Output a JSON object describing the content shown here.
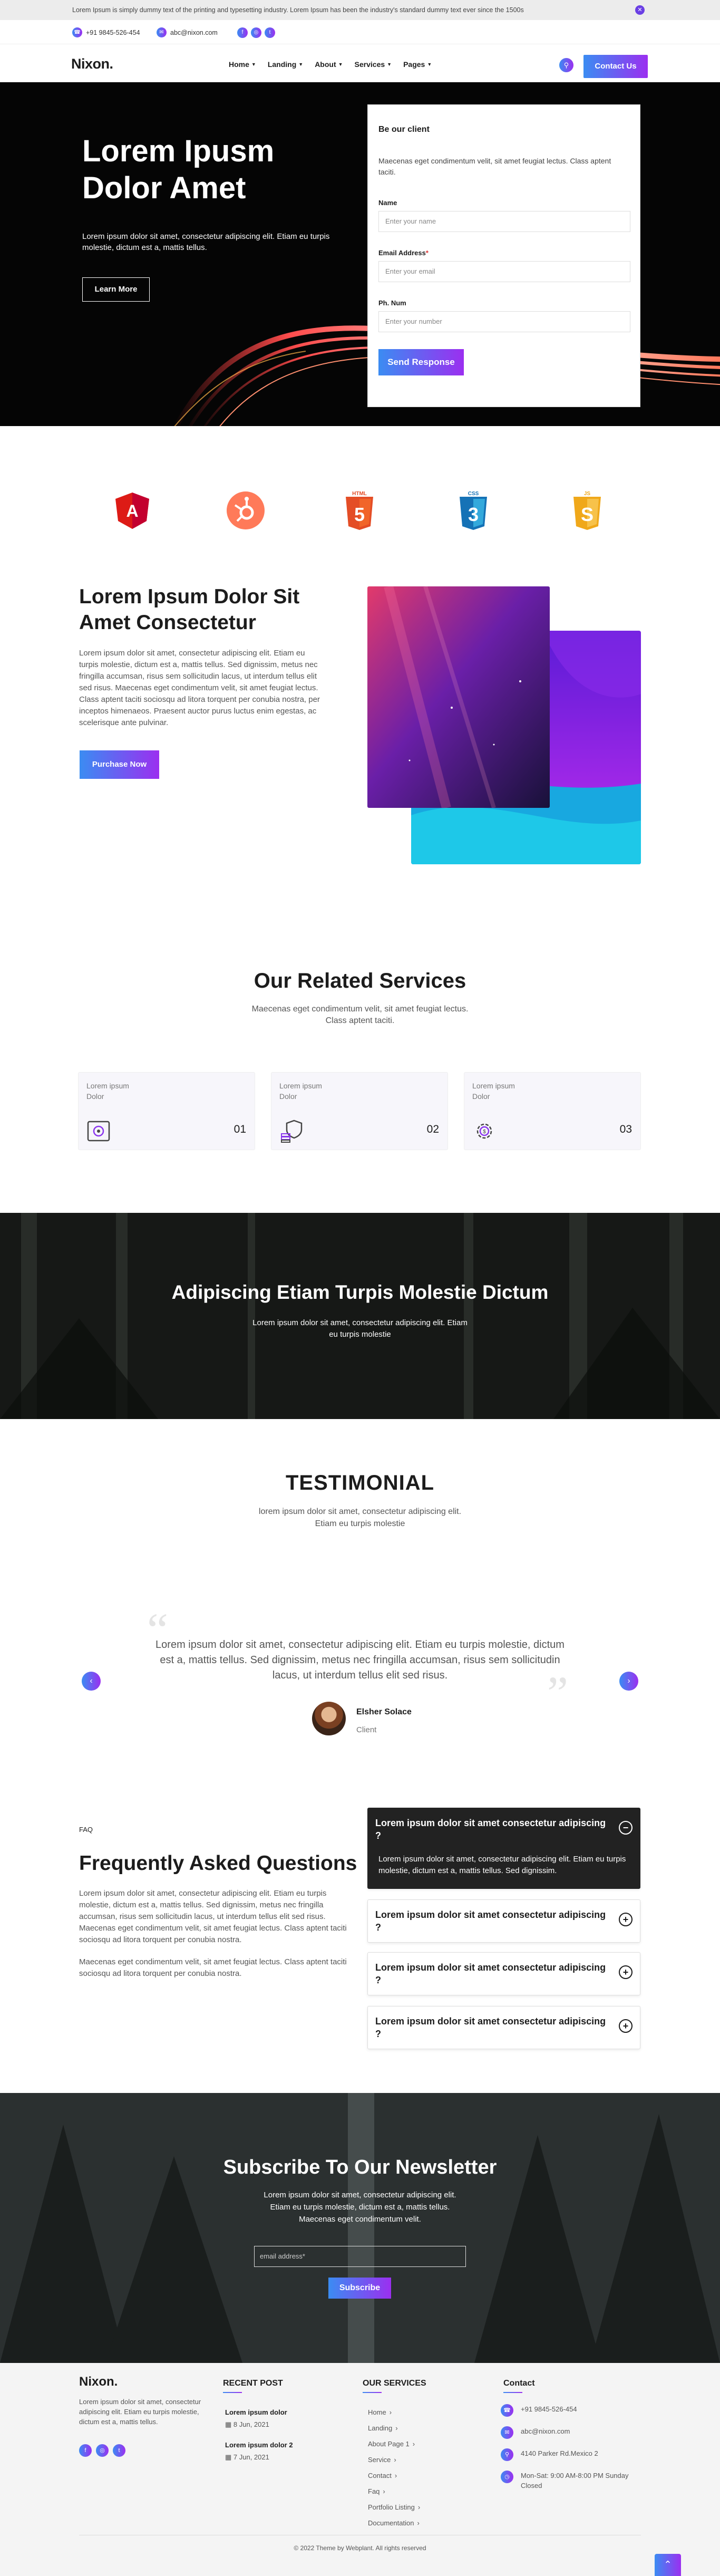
{
  "topbar": {
    "text": "Lorem Ipsum is simply dummy text of the printing and typesetting industry. Lorem Ipsum has been the industry's standard dummy text ever since the 1500s",
    "close_icon": "x-icon"
  },
  "contact": {
    "phone": "+91 9845-526-454",
    "email": "abc@nixon.com"
  },
  "nav": {
    "logo": "Nixon.",
    "items": [
      "Home",
      "Landing",
      "About",
      "Services",
      "Pages"
    ],
    "cta": "Contact Us"
  },
  "hero": {
    "title": "Lorem Ipusm Dolor Amet",
    "text": "Lorem ipsum dolor sit amet, consectetur adipiscing elit. Etiam eu turpis molestie, dictum est a, mattis tellus.",
    "button": "Learn More"
  },
  "form": {
    "title": "Be our client",
    "text": "Maecenas eget condimentum velit, sit amet feugiat lectus. Class aptent taciti.",
    "name_label": "Name",
    "name_ph": "Enter your name",
    "email_label": "Email Address",
    "req": "*",
    "email_ph": "Enter your email",
    "phone_label": "Ph. Num",
    "phone_ph": "Enter your number",
    "button": "Send Response"
  },
  "logos": [
    {
      "name": "angular",
      "text": "A",
      "color": "#dd1b16"
    },
    {
      "name": "hubspot",
      "text": "",
      "color": "#ff7a59"
    },
    {
      "name": "html5",
      "text": "5",
      "label": "HTML",
      "color": "#e44d26"
    },
    {
      "name": "css3",
      "text": "3",
      "label": "CSS",
      "color": "#1572b6"
    },
    {
      "name": "js",
      "text": "S",
      "label": "JS",
      "color": "#f0a81a"
    }
  ],
  "about": {
    "title": "Lorem Ipsum Dolor Sit Amet Consectetur",
    "text": "Lorem ipsum dolor sit amet, consectetur adipiscing elit. Etiam eu turpis molestie, dictum est a, mattis tellus. Sed dignissim, metus nec fringilla accumsan, risus sem sollicitudin lacus, ut interdum tellus elit sed risus. Maecenas eget condimentum velit, sit amet feugiat lectus. Class aptent taciti sociosqu ad litora torquent per conubia nostra, per inceptos himenaeos. Praesent auctor purus luctus enim egestas, ac scelerisque ante pulvinar.",
    "button": "Purchase Now"
  },
  "services": {
    "title": "Our Related Services",
    "sub": "Maecenas eget condimentum velit, sit amet feugiat lectus. Class aptent taciti.",
    "cards": [
      {
        "label": "Lorem ipsum Dolor",
        "num": "01",
        "icon": "safe-icon"
      },
      {
        "label": "Lorem ipsum Dolor",
        "num": "02",
        "icon": "shield-coins-icon"
      },
      {
        "label": "Lorem ipsum Dolor",
        "num": "03",
        "icon": "gear-dollar-icon"
      }
    ]
  },
  "band": {
    "title": "Adipiscing Etiam Turpis Molestie Dictum",
    "text": "Lorem ipsum dolor sit amet, consectetur adipiscing elit. Etiam eu turpis molestie"
  },
  "testimonial": {
    "title": "TESTIMONIAL",
    "sub": "lorem ipsum dolor sit amet, consectetur adipiscing elit. Etiam eu turpis molestie",
    "quote": "Lorem ipsum dolor sit amet, consectetur adipiscing elit. Etiam eu turpis molestie, dictum est a, mattis tellus. Sed dignissim, metus nec fringilla accumsan, risus sem sollicitudin lacus, ut interdum tellus elit sed risus.",
    "name": "Elsher Solace",
    "role": "Client"
  },
  "faq": {
    "label": "FAQ",
    "title": "Frequently Asked Questions",
    "text1": "Lorem ipsum dolor sit amet, consectetur adipiscing elit. Etiam eu turpis molestie, dictum est a, mattis tellus. Sed dignissim, metus nec fringilla accumsan, risus sem sollicitudin lacus, ut interdum tellus elit sed risus. Maecenas eget condimentum velit, sit amet feugiat lectus. Class aptent taciti sociosqu ad litora torquent per conubia nostra.",
    "text2": "Maecenas eget condimentum velit, sit amet feugiat lectus. Class aptent taciti sociosqu ad litora torquent per conubia nostra.",
    "items": [
      {
        "q": "Lorem ipsum dolor sit amet consectetur adipiscing ?",
        "a": "Lorem ipsum dolor sit amet, consectetur adipiscing elit. Etiam eu turpis molestie, dictum est a, mattis tellus. Sed dignissim.",
        "open": true
      },
      {
        "q": "Lorem ipsum dolor sit amet consectetur adipiscing ?"
      },
      {
        "q": "Lorem ipsum dolor sit amet consectetur adipiscing ?"
      },
      {
        "q": "Lorem ipsum dolor sit amet consectetur adipiscing ?"
      }
    ]
  },
  "newsletter": {
    "title": "Subscribe To Our Newsletter",
    "text": "Lorem ipsum dolor sit amet, consectetur adipiscing elit. Etiam eu turpis molestie, dictum est a, mattis tellus. Maecenas eget condimentum velit.",
    "placeholder": "email address*",
    "button": "Subscribe"
  },
  "footer": {
    "logo": "Nixon.",
    "text": "Lorem ipsum dolor sit amet, consectetur adipiscing elit. Etiam eu turpis molestie, dictum est a, mattis tellus.",
    "recent_title": "RECENT POST",
    "posts": [
      {
        "title": "Lorem ipsum dolor",
        "date": "8 Jun, 2021"
      },
      {
        "title": "Lorem ipsum dolor 2",
        "date": "7 Jun, 2021"
      }
    ],
    "services_title": "OUR SERVICES",
    "services": [
      "Home",
      "Landing",
      "About Page 1",
      "Service",
      "Contact",
      "Faq",
      "Portfolio Listing",
      "Documentation"
    ],
    "contact_title": "Contact",
    "phone": "+91 9845-526-454",
    "email": "abc@nixon.com",
    "address": "4140 Parker Rd.Mexico 2",
    "hours": "Mon-Sat: 9:00 AM-8:00 PM Sunday Closed",
    "copyright": "© 2022 Theme by Webplant. All rights reserved"
  }
}
